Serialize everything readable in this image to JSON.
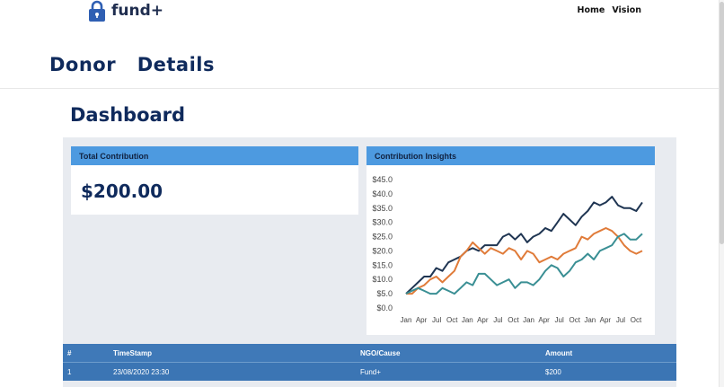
{
  "brand": {
    "name": "fund+",
    "icon": "lock-icon"
  },
  "nav": {
    "items": [
      "Home",
      "Vision"
    ]
  },
  "page_title": "Donor  Details",
  "section_title": "Dashboard",
  "total_card": {
    "header": "Total Contribution",
    "amount": "$200.00"
  },
  "insights_card": {
    "header": "Contribution Insights"
  },
  "chart_data": {
    "type": "line",
    "title": "",
    "xlabel": "",
    "ylabel": "",
    "ylim": [
      0,
      45
    ],
    "yticks": [
      "$0.0",
      "$5.0",
      "$10.0",
      "$15.0",
      "$20.0",
      "$25.0",
      "$30.0",
      "$35.0",
      "$40.0",
      "$45.0"
    ],
    "xticks": [
      "Jan",
      "Apr",
      "Jul",
      "Oct",
      "Jan",
      "Apr",
      "Jul",
      "Oct",
      "Jan",
      "Apr",
      "Jul",
      "Oct",
      "Jan",
      "Apr",
      "Jul",
      "Oct"
    ],
    "grid": false,
    "colors": [
      "#1f3552",
      "#e07b39",
      "#3a8f94"
    ],
    "series": [
      {
        "values": [
          5,
          7,
          9,
          11,
          11,
          14,
          13,
          16,
          17,
          18,
          20,
          21,
          20,
          22,
          22,
          22,
          25,
          26,
          24,
          26,
          23,
          25,
          26,
          28,
          27,
          30,
          33,
          31,
          29,
          32,
          34,
          37,
          36,
          37,
          39,
          36,
          35,
          35,
          34,
          37
        ]
      },
      {
        "values": [
          5,
          5,
          7,
          8,
          10,
          11,
          9,
          11,
          13,
          18,
          20,
          23,
          21,
          19,
          21,
          20,
          19,
          21,
          20,
          17,
          20,
          19,
          16,
          17,
          18,
          17,
          19,
          20,
          21,
          25,
          24,
          26,
          27,
          28,
          27,
          25,
          22,
          20,
          19,
          20
        ]
      },
      {
        "values": [
          5,
          6,
          7,
          6,
          5,
          5,
          7,
          6,
          5,
          7,
          9,
          8,
          12,
          12,
          10,
          8,
          9,
          10,
          7,
          9,
          9,
          8,
          10,
          13,
          15,
          14,
          11,
          13,
          16,
          17,
          19,
          17,
          20,
          21,
          22,
          25,
          26,
          24,
          24,
          26
        ]
      }
    ]
  },
  "table": {
    "headers": [
      "#",
      "TimeStamp",
      "NGO/Cause",
      "Amount"
    ],
    "rows": [
      [
        "1",
        "23/08/2020 23:30",
        "Fund+",
        "$200"
      ]
    ]
  }
}
